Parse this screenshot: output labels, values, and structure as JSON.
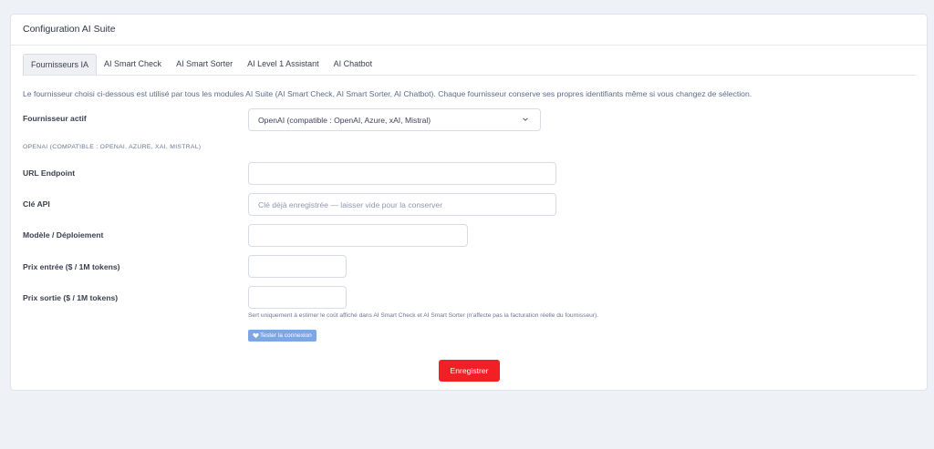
{
  "header": {
    "title": "Configuration AI Suite"
  },
  "tabs": [
    {
      "label": "Fournisseurs IA",
      "active": true
    },
    {
      "label": "AI Smart Check",
      "active": false
    },
    {
      "label": "AI Smart Sorter",
      "active": false
    },
    {
      "label": "AI Level 1 Assistant",
      "active": false
    },
    {
      "label": "AI Chatbot",
      "active": false
    }
  ],
  "intro": "Le fournisseur choisi ci-dessous est utilisé par tous les modules AI Suite (AI Smart Check, AI Smart Sorter, AI Chatbot). Chaque fournisseur conserve ses propres identifiants même si vous changez de sélection.",
  "provider": {
    "label": "Fournisseur actif",
    "selected": "OpenAI (compatible : OpenAI, Azure, xAI, Mistral)"
  },
  "section_title": "OPENAI (COMPATIBLE : OPENAI, AZURE, XAI, MISTRAL)",
  "fields": {
    "endpoint": {
      "label": "URL Endpoint",
      "value": ""
    },
    "api_key": {
      "label": "Clé API",
      "placeholder": "Clé déjà enregistrée — laisser vide pour la conserver",
      "value": ""
    },
    "model": {
      "label": "Modèle / Déploiement",
      "value": ""
    },
    "price_in": {
      "label": "Prix entrée ($ / 1M tokens)",
      "value": ""
    },
    "price_out": {
      "label": "Prix sortie ($ / 1M tokens)",
      "value": ""
    }
  },
  "hint": "Sert uniquement à estimer le coût affiché dans AI Smart Check et AI Smart Sorter (n'affecte pas la facturation réelle du fournisseur).",
  "buttons": {
    "test_label": "Tester la connexion",
    "test_icon": "heart-icon",
    "save_label": "Enregistrer"
  },
  "colors": {
    "accent": "#f21f24",
    "test_button": "#7ba7e6",
    "background": "#eef1f6"
  }
}
